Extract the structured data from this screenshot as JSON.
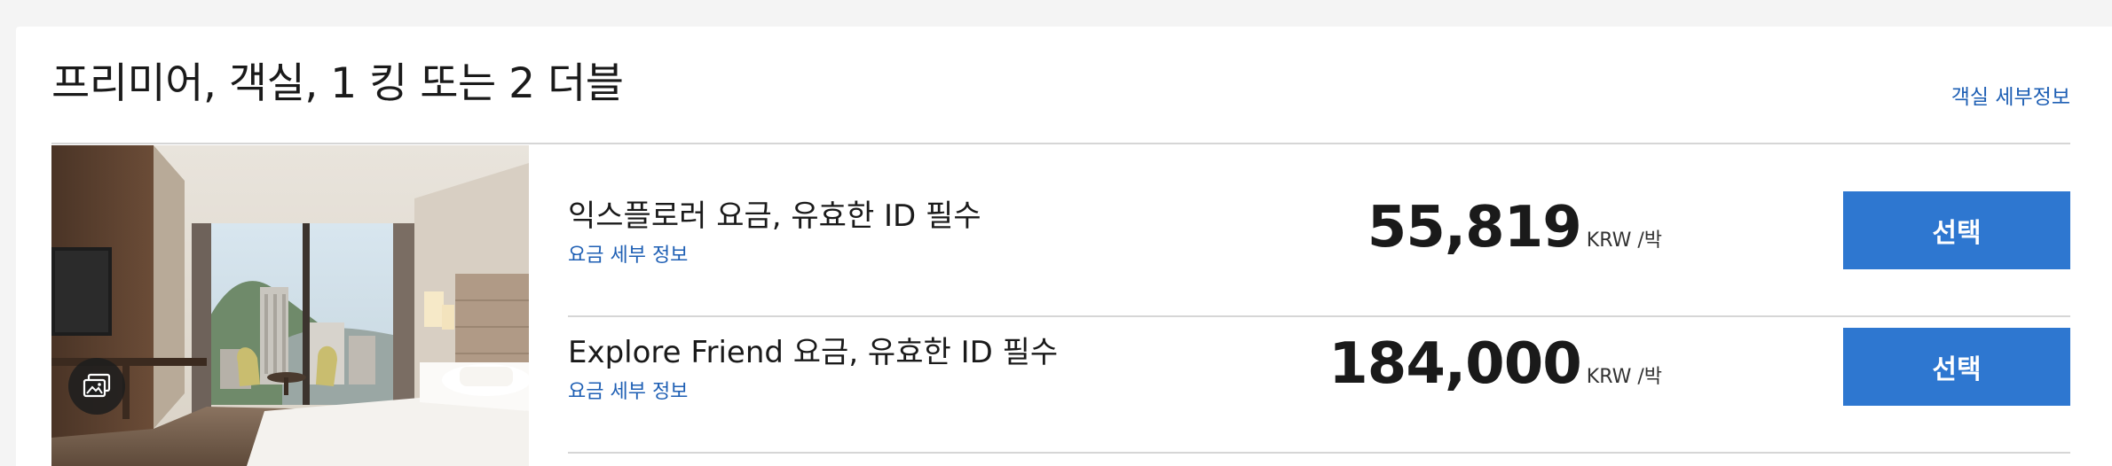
{
  "room": {
    "title": "프리미어, 객실, 1 킹 또는 2 더블",
    "details_link": "객실 세부정보",
    "image_alt": "객실 사진"
  },
  "rates": [
    {
      "name": "익스플로러 요금, 유효한 ID 필수",
      "details_link": "요금 세부 정보",
      "price": "55,819",
      "unit": "KRW /박",
      "select_label": "선택"
    },
    {
      "name": "Explore Friend 요금, 유효한 ID 필수",
      "details_link": "요금 세부 정보",
      "price": "184,000",
      "unit": "KRW /박",
      "select_label": "선택"
    }
  ],
  "icons": {
    "gallery": "gallery-icon"
  },
  "colors": {
    "link": "#1e5fb4",
    "button": "#2e77d0",
    "button_text": "#ffffff",
    "divider": "#d6d6d6",
    "page_background": "#f4f4f4"
  }
}
